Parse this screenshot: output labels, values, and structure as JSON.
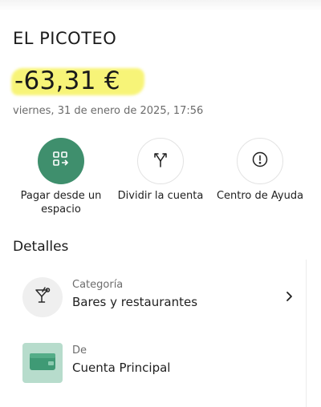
{
  "merchant": {
    "name": "EL PICOTEO"
  },
  "transaction": {
    "amount": "-63,31 €",
    "datetime": "viernes, 31 de enero de 2025, 17:56"
  },
  "colors": {
    "accent": "#3f8f6d",
    "highlight": "#f7f36a"
  },
  "actions": [
    {
      "label": "Pagar desde un espacio",
      "icon": "qr-transfer-icon"
    },
    {
      "label": "Dividir la cuenta",
      "icon": "split-arrows-icon"
    },
    {
      "label": "Centro de Ayuda",
      "icon": "alert-circle-icon"
    }
  ],
  "details": {
    "title": "Detalles",
    "rows": [
      {
        "caption": "Categoría",
        "value": "Bares y restaurantes",
        "icon": "cocktail-icon"
      },
      {
        "caption": "De",
        "value": "Cuenta Principal",
        "icon": "wallet-card-icon"
      }
    ]
  }
}
